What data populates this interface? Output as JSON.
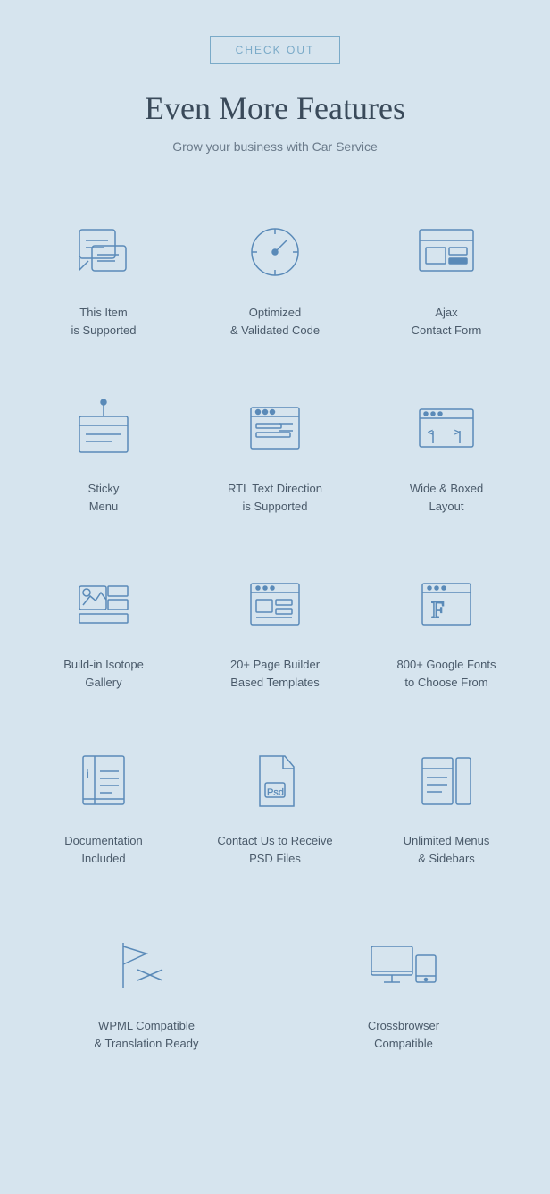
{
  "header": {
    "checkout_btn": "CHECK OUT",
    "title": "Even More Features",
    "subtitle": "Grow your business with Car Service"
  },
  "features": [
    {
      "id": "supported",
      "label_line1": "This Item",
      "label_line2": "is Supported",
      "icon": "supported"
    },
    {
      "id": "optimized",
      "label_line1": "Optimized",
      "label_line2": "& Validated Code",
      "icon": "optimized"
    },
    {
      "id": "ajax",
      "label_line1": "Ajax",
      "label_line2": "Contact Form",
      "icon": "ajax"
    },
    {
      "id": "sticky",
      "label_line1": "Sticky",
      "label_line2": "Menu",
      "icon": "sticky"
    },
    {
      "id": "rtl",
      "label_line1": "RTL Text Direction",
      "label_line2": "is Supported",
      "icon": "rtl"
    },
    {
      "id": "wide",
      "label_line1": "Wide & Boxed",
      "label_line2": "Layout",
      "icon": "wide"
    },
    {
      "id": "isotope",
      "label_line1": "Build-in Isotope",
      "label_line2": "Gallery",
      "icon": "isotope"
    },
    {
      "id": "pagebuilder",
      "label_line1": "20+ Page Builder",
      "label_line2": "Based Templates",
      "icon": "pagebuilder"
    },
    {
      "id": "fonts",
      "label_line1": "800+ Google Fonts",
      "label_line2": "to Choose From",
      "icon": "fonts"
    },
    {
      "id": "docs",
      "label_line1": "Documentation",
      "label_line2": "Included",
      "icon": "docs"
    },
    {
      "id": "psd",
      "label_line1": "Contact Us to Receive",
      "label_line2": "PSD Files",
      "icon": "psd"
    },
    {
      "id": "menus",
      "label_line1": "Unlimited Menus",
      "label_line2": "& Sidebars",
      "icon": "menus"
    },
    {
      "id": "wpml",
      "label_line1": "WPML Compatible",
      "label_line2": "& Translation Ready",
      "icon": "wpml"
    },
    {
      "id": "crossbrowser",
      "label_line1": "Crossbrowser",
      "label_line2": "Compatible",
      "icon": "crossbrowser"
    }
  ]
}
